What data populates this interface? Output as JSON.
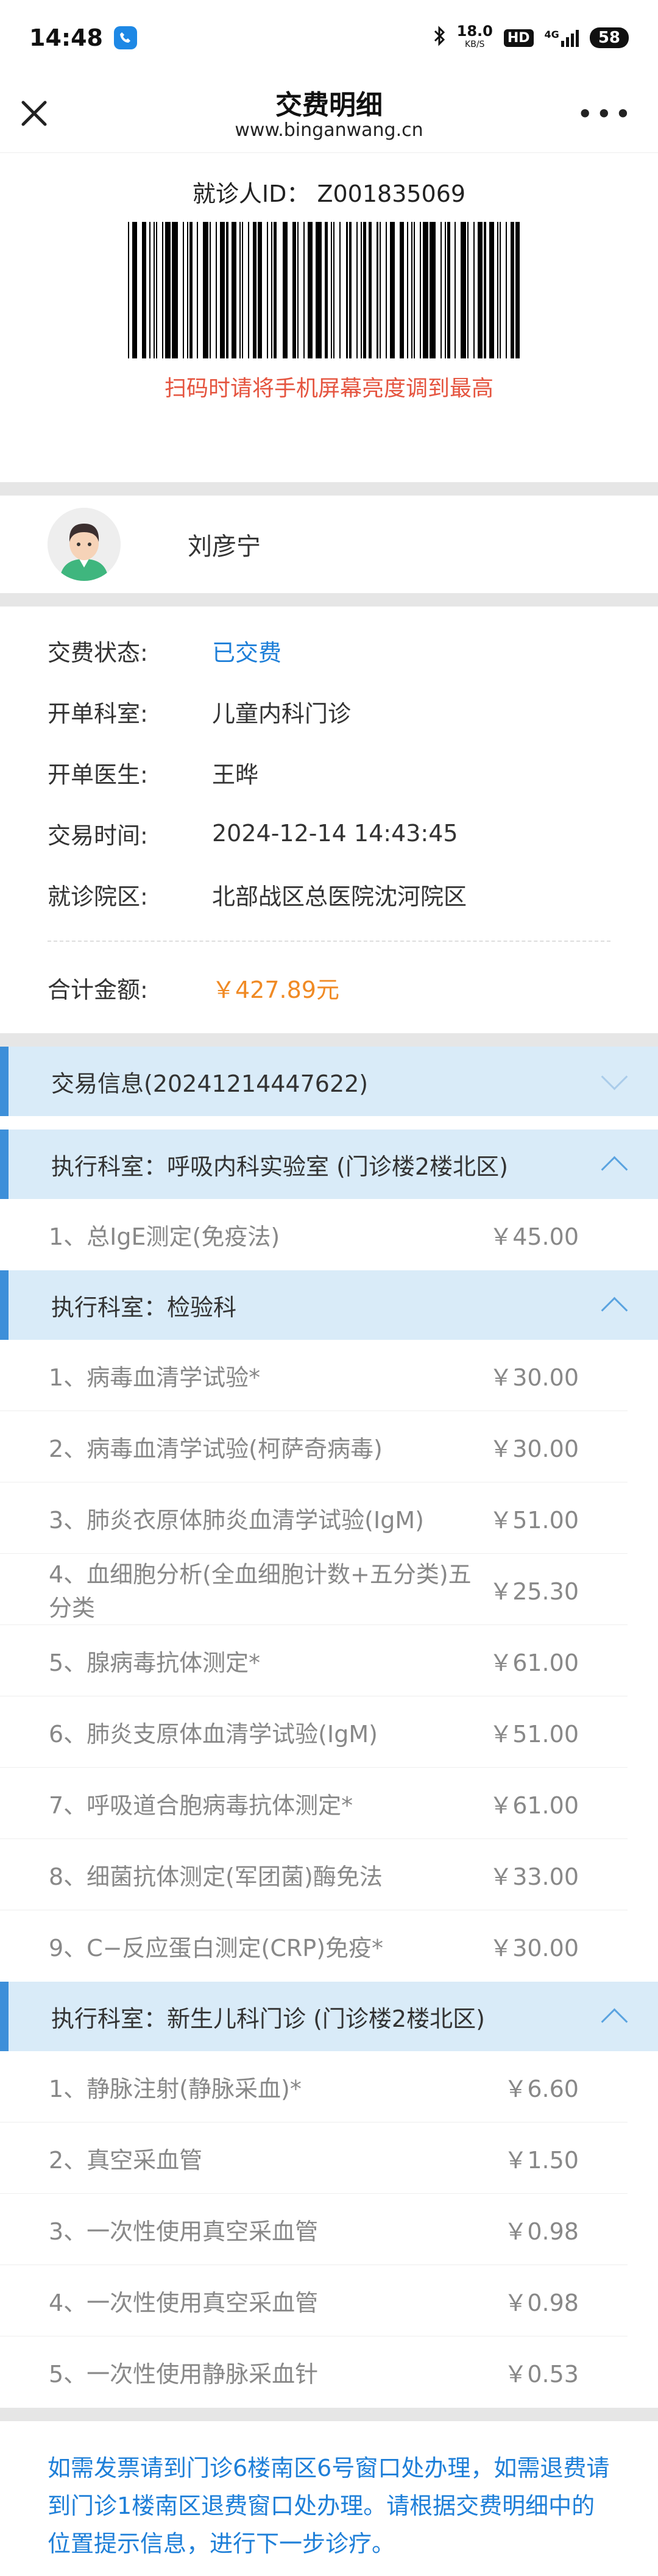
{
  "status_bar": {
    "time": "14:48",
    "network_speed": "18.0",
    "speed_unit": "KB/S",
    "hd": "HD",
    "signal": "4G",
    "battery": "58"
  },
  "nav": {
    "title": "交费明细",
    "url": "www.binganwang.cn"
  },
  "barcode": {
    "id_label": "就诊人ID：",
    "id_value": "Z001835069",
    "tip": "扫码时请将手机屏幕亮度调到最高"
  },
  "patient": {
    "name": "刘彦宁"
  },
  "info": {
    "rows": [
      {
        "label": "交费状态:",
        "value": "已交费"
      },
      {
        "label": "开单科室:",
        "value": "儿童内科门诊"
      },
      {
        "label": "开单医生:",
        "value": "王晔"
      },
      {
        "label": "交易时间:",
        "value": "2024-12-14 14:43:45"
      },
      {
        "label": "就诊院区:",
        "value": "北部战区总医院沈河院区"
      }
    ],
    "total_label": "合计金额:",
    "total_value": "￥427.89元"
  },
  "trade_section": {
    "title": "交易信息(20241214447622)"
  },
  "dept1": {
    "title": "执行科室：呼吸内科实验室 (门诊楼2楼北区)",
    "items": [
      {
        "name": "1、总IgE测定(免疫法)",
        "price": "￥45.00"
      }
    ]
  },
  "dept2": {
    "title": "执行科室：检验科",
    "items": [
      {
        "name": "1、病毒血清学试验*",
        "price": "￥30.00"
      },
      {
        "name": "2、病毒血清学试验(柯萨奇病毒)",
        "price": "￥30.00"
      },
      {
        "name": "3、肺炎衣原体肺炎血清学试验(IgM)",
        "price": "￥51.00"
      },
      {
        "name": "4、血细胞分析(全血细胞计数+五分类)五分类",
        "price": "￥25.30"
      },
      {
        "name": "5、腺病毒抗体测定*",
        "price": "￥61.00"
      },
      {
        "name": "6、肺炎支原体血清学试验(IgM)",
        "price": "￥51.00"
      },
      {
        "name": "7、呼吸道合胞病毒抗体测定*",
        "price": "￥61.00"
      },
      {
        "name": "8、细菌抗体测定(军团菌)酶免法",
        "price": "￥33.00"
      },
      {
        "name": "9、C−反应蛋白测定(CRP)免疫*",
        "price": "￥30.00"
      }
    ]
  },
  "dept3": {
    "title": "执行科室：新生儿科门诊 (门诊楼2楼北区)",
    "items": [
      {
        "name": "1、静脉注射(静脉采血)*",
        "price": "￥6.60"
      },
      {
        "name": "2、真空采血管",
        "price": "￥1.50"
      },
      {
        "name": "3、一次性使用真空采血管",
        "price": "￥0.98"
      },
      {
        "name": "4、一次性使用真空采血管",
        "price": "￥0.98"
      },
      {
        "name": "5、一次性使用静脉采血针",
        "price": "￥0.53"
      }
    ]
  },
  "note": "如需发票请到门诊6楼南区6号窗口处办理，如需退费请到门诊1楼南区退费窗口处办理。请根据交费明细中的位置提示信息，进行下一步诊疗。"
}
